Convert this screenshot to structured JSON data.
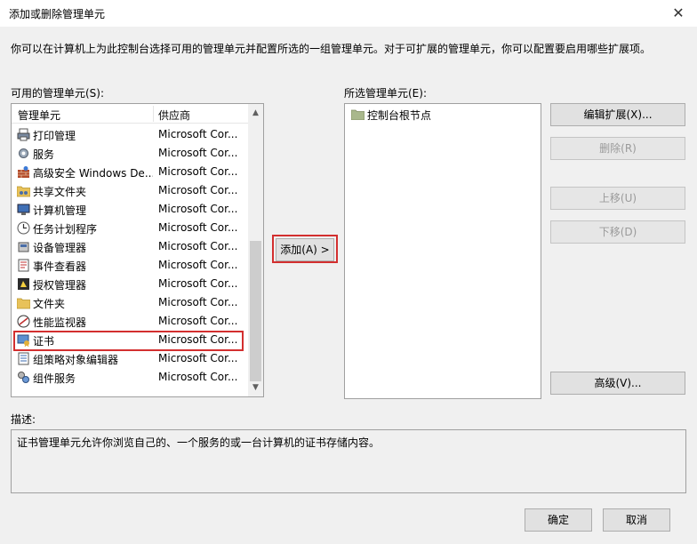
{
  "window": {
    "title": "添加或删除管理单元",
    "close_glyph": "✕"
  },
  "intro": "你可以在计算机上为此控制台选择可用的管理单元并配置所选的一组管理单元。对于可扩展的管理单元，你可以配置要启用哪些扩展项。",
  "available": {
    "label": "可用的管理单元(S):",
    "col_name": "管理单元",
    "col_vendor": "供应商",
    "items": [
      {
        "name": "打印管理",
        "vendor": "Microsoft Cor...",
        "icon": "printer-icon"
      },
      {
        "name": "服务",
        "vendor": "Microsoft Cor...",
        "icon": "gear-icon"
      },
      {
        "name": "高级安全 Windows De...",
        "vendor": "Microsoft Cor...",
        "icon": "firewall-icon"
      },
      {
        "name": "共享文件夹",
        "vendor": "Microsoft Cor...",
        "icon": "shared-folder-icon"
      },
      {
        "name": "计算机管理",
        "vendor": "Microsoft Cor...",
        "icon": "computer-management-icon"
      },
      {
        "name": "任务计划程序",
        "vendor": "Microsoft Cor...",
        "icon": "clock-icon"
      },
      {
        "name": "设备管理器",
        "vendor": "Microsoft Cor...",
        "icon": "device-manager-icon"
      },
      {
        "name": "事件查看器",
        "vendor": "Microsoft Cor...",
        "icon": "event-viewer-icon"
      },
      {
        "name": "授权管理器",
        "vendor": "Microsoft Cor...",
        "icon": "authorization-icon"
      },
      {
        "name": "文件夹",
        "vendor": "Microsoft Cor...",
        "icon": "folder-icon"
      },
      {
        "name": "性能监视器",
        "vendor": "Microsoft Cor...",
        "icon": "performance-icon"
      },
      {
        "name": "证书",
        "vendor": "Microsoft Cor...",
        "icon": "certificate-icon"
      },
      {
        "name": "组策略对象编辑器",
        "vendor": "Microsoft Cor...",
        "icon": "group-policy-icon"
      },
      {
        "name": "组件服务",
        "vendor": "Microsoft Cor...",
        "icon": "component-services-icon"
      }
    ],
    "selected_index": 11
  },
  "add_button": "添加(A) >",
  "selected": {
    "label": "所选管理单元(E):",
    "items": [
      {
        "name": "控制台根节点",
        "icon": "folder-icon"
      }
    ]
  },
  "buttons": {
    "edit_extensions": "编辑扩展(X)...",
    "remove": "删除(R)",
    "move_up": "上移(U)",
    "move_down": "下移(D)",
    "advanced": "高级(V)...",
    "ok": "确定",
    "cancel": "取消"
  },
  "description": {
    "label": "描述:",
    "text": "证书管理单元允许你浏览自己的、一个服务的或一台计算机的证书存储内容。"
  },
  "colors": {
    "highlight_border": "#d32f2f",
    "folder_yellow": "#e8c25a"
  }
}
